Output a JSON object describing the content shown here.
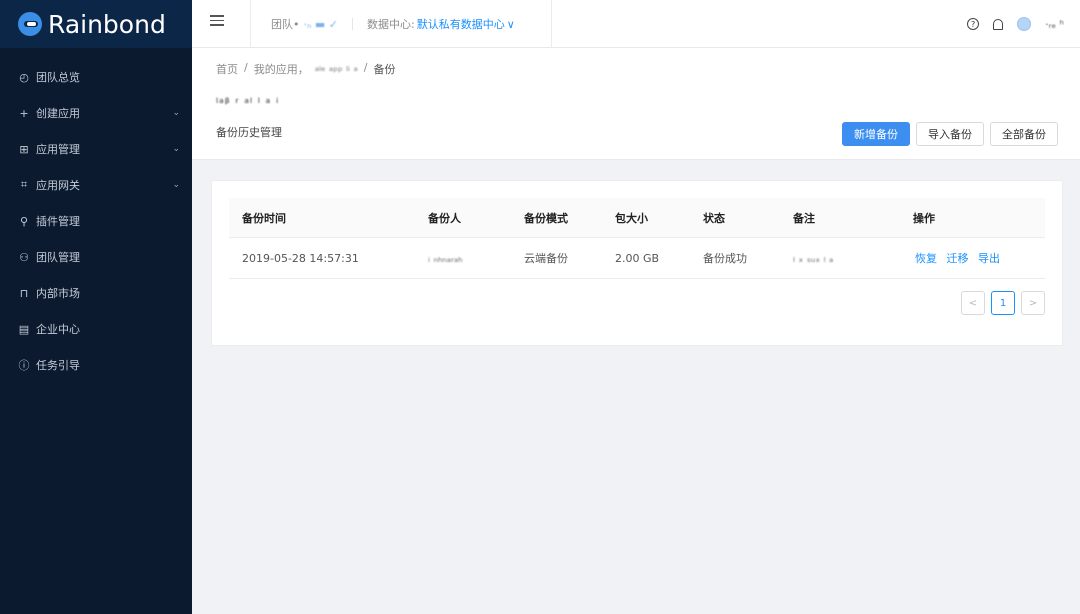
{
  "brand": {
    "name": "Rainbond"
  },
  "sidebar": {
    "items": [
      {
        "label": "团队总览",
        "icon": "dashboard-icon",
        "chevron": false
      },
      {
        "label": "创建应用",
        "icon": "plus-icon",
        "chevron": true
      },
      {
        "label": "应用管理",
        "icon": "grid-icon",
        "chevron": true
      },
      {
        "label": "应用网关",
        "icon": "gateway-icon",
        "chevron": true
      },
      {
        "label": "插件管理",
        "icon": "plugin-icon",
        "chevron": false
      },
      {
        "label": "团队管理",
        "icon": "team-icon",
        "chevron": false
      },
      {
        "label": "内部市场",
        "icon": "market-icon",
        "chevron": false
      },
      {
        "label": "企业中心",
        "icon": "enterprise-icon",
        "chevron": false
      },
      {
        "label": "任务引导",
        "icon": "info-icon",
        "chevron": false
      }
    ]
  },
  "header": {
    "team_label": "团队•",
    "team_value": "·ₙ ▬ ✓",
    "datacenter_label": "数据中心:",
    "datacenter_value": "默认私有数据中心",
    "username": "·ᵣₑ ʰ"
  },
  "breadcrumb": {
    "home": "首页",
    "my_apps": "我的应用，",
    "app": "ₐₗₑ ₐₚₚ ₗᵢ ₐ",
    "current": "备份"
  },
  "page": {
    "app_title": "ₗₐᵦ ᵣ ₐₗ ₗ ₐ ᵢ",
    "subtitle": "备份历史管理",
    "buttons": {
      "add": "新增备份",
      "import": "导入备份",
      "all": "全部备份"
    }
  },
  "table": {
    "headers": [
      "备份时间",
      "备份人",
      "备份模式",
      "包大小",
      "状态",
      "备注",
      "操作"
    ],
    "rows": [
      {
        "time": "2019-05-28 14:57:31",
        "user": "ᵢ ₙₕₙₐᵣₐₕ",
        "mode": "云端备份",
        "size": "2.00 GB",
        "status": "备份成功",
        "note": "ₗ ₓ ₛᵤₓ ₗ ₐ",
        "actions": [
          "恢复",
          "迁移",
          "导出"
        ]
      }
    ]
  },
  "pagination": {
    "prev": "<",
    "current": "1",
    "next": ">"
  }
}
